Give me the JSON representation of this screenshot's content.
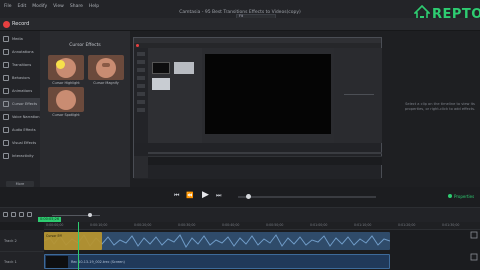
{
  "menubar": {
    "items": [
      "File",
      "Edit",
      "Modify",
      "View",
      "Share",
      "Help"
    ],
    "doc_title": "Camtasia - 95 Best Transitions Effects to Videos(copy)",
    "zoom": "Fit"
  },
  "logo": {
    "name": "REPTO",
    "tagline": "Tools for Video",
    "share": "Share"
  },
  "record": {
    "label": "Record"
  },
  "tools": [
    "Media",
    "Annotations",
    "Transitions",
    "Behaviors",
    "Animations",
    "Cursor Effects",
    "Voice Narration",
    "Audio Effects",
    "Visual Effects",
    "Interactivity"
  ],
  "more_label": "More",
  "effects": {
    "header": "Cursor Effects",
    "items": [
      "Cursor Highlight",
      "Cursor Magnify",
      "Cursor Spotlight"
    ]
  },
  "canvas_note": "Select a clip on the timeline to view its properties, or right-click to add effects.",
  "properties_label": "Properties",
  "controls": {
    "prev": "⏮",
    "back": "⏪",
    "play": "▶",
    "next": "⏭"
  },
  "timeline": {
    "playhead_time": "0:00:05;26",
    "ticks": [
      "0:00:00;00",
      "0:00:10;00",
      "0:00:20;00",
      "0:00:30;00",
      "0:00:40;00",
      "0:00:50;00",
      "0:01:00;00",
      "0:01:10;00",
      "0:01:20;00",
      "0:01:30;00"
    ],
    "tracks": [
      "Track 2",
      "Track 1"
    ],
    "effect_clip": "Cursor Eff",
    "main_clip": "Rec 10-13-19_002.trec (Screen)"
  },
  "colors": {
    "accent": "#2ecc71",
    "record": "#e64040",
    "clip_audio": "#2f4b6a",
    "clip_effect": "#b9952e"
  }
}
